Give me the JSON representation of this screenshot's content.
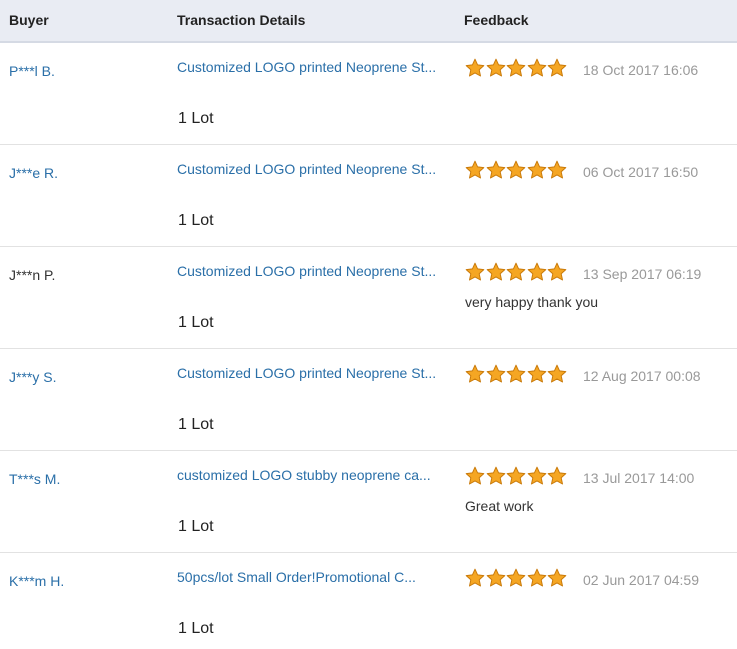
{
  "header": {
    "buyer": "Buyer",
    "transaction_details": "Transaction Details",
    "feedback": "Feedback"
  },
  "colors": {
    "link": "#2a6fa8",
    "star_fill": "#f5a623",
    "star_stroke": "#c97a0a",
    "header_bg": "#e9ecf3"
  },
  "rows": [
    {
      "buyer": "P***l B.",
      "buyer_link": true,
      "product": "Customized LOGO printed Neoprene St...",
      "quantity": "1 Lot",
      "stars": 5,
      "date": "18 Oct 2017 16:06",
      "comment": ""
    },
    {
      "buyer": "J***e R.",
      "buyer_link": true,
      "product": "Customized LOGO printed Neoprene St...",
      "quantity": "1 Lot",
      "stars": 5,
      "date": "06 Oct 2017 16:50",
      "comment": ""
    },
    {
      "buyer": "J***n P.",
      "buyer_link": false,
      "product": "Customized LOGO printed Neoprene St...",
      "quantity": "1 Lot",
      "stars": 5,
      "date": "13 Sep 2017 06:19",
      "comment": "very happy thank you"
    },
    {
      "buyer": "J***y S.",
      "buyer_link": true,
      "product": "Customized LOGO printed Neoprene St...",
      "quantity": "1 Lot",
      "stars": 5,
      "date": "12 Aug 2017 00:08",
      "comment": ""
    },
    {
      "buyer": "T***s M.",
      "buyer_link": true,
      "product": "customized LOGO stubby neoprene ca...",
      "quantity": "1 Lot",
      "stars": 5,
      "date": "13 Jul 2017 14:00",
      "comment": "Great work"
    },
    {
      "buyer": "K***m H.",
      "buyer_link": true,
      "product": "50pcs/lot Small Order!Promotional C...",
      "quantity": "1 Lot",
      "stars": 5,
      "date": "02 Jun 2017 04:59",
      "comment": ""
    }
  ]
}
